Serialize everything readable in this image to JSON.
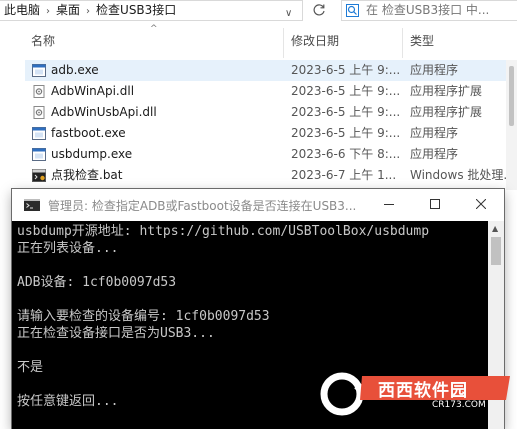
{
  "explorer": {
    "breadcrumb": [
      "此电脑",
      "桌面",
      "检查USB3接口"
    ],
    "search_placeholder": "在 检查USB3接口 中...",
    "columns": {
      "name": "名称",
      "date": "修改日期",
      "type": "类型"
    },
    "files": [
      {
        "name": "adb.exe",
        "date": "2023-6-5 上午 9:...",
        "type": "应用程序",
        "icon": "exe-icon",
        "selected": true
      },
      {
        "name": "AdbWinApi.dll",
        "date": "2023-6-5 上午 9:...",
        "type": "应用程序扩展",
        "icon": "dll-icon"
      },
      {
        "name": "AdbWinUsbApi.dll",
        "date": "2023-6-5 上午 9:...",
        "type": "应用程序扩展",
        "icon": "dll-icon"
      },
      {
        "name": "fastboot.exe",
        "date": "2023-6-5 上午 9:...",
        "type": "应用程序",
        "icon": "exe-icon"
      },
      {
        "name": "usbdump.exe",
        "date": "2023-6-6 下午 8:...",
        "type": "应用程序",
        "icon": "exe-icon"
      },
      {
        "name": "点我检查.bat",
        "date": "2023-6-7 上午 1...",
        "type": "Windows 批处理...",
        "icon": "bat-icon"
      }
    ]
  },
  "console": {
    "title": "管理员: 检查指定ADB或Fastboot设备是否连接在USB3...",
    "lines": [
      "usbdump开源地址: https://github.com/USBToolBox/usbdump",
      "正在列表设备...",
      "",
      "ADB设备: 1cf0b0097d53",
      "",
      "请输入要检查的设备编号: 1cf0b0097d53",
      "正在检查设备接口是否为USB3...",
      "",
      "不是",
      "",
      "按任意键返回..."
    ]
  },
  "watermark": {
    "text": "西西软件园",
    "sub": "CR173.COM"
  },
  "colors": {
    "console_bg": "#000000",
    "console_text": "#c8c8c8",
    "selection": "#e6f1fb",
    "watermark": "#e8503a"
  }
}
